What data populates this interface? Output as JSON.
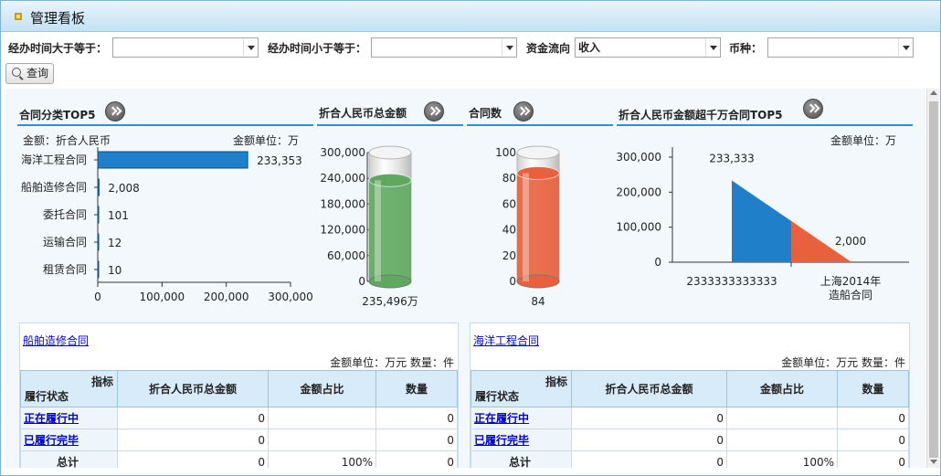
{
  "window": {
    "title": "管理看板"
  },
  "filters": [
    {
      "label": "经办时间大于等于：",
      "value": ""
    },
    {
      "label": "经办时间小于等于：",
      "value": ""
    },
    {
      "label": "资金流向",
      "value": "收入"
    },
    {
      "label": "币种：",
      "value": ""
    }
  ],
  "query_button": "查询",
  "sections": {
    "s1": "合同分类TOP5",
    "s2": "折合人民币总金额",
    "s3": "合同数",
    "s4": "折合人民币金额超千万合同TOP5"
  },
  "chart_data": [
    {
      "type": "bar",
      "title": "合同分类TOP5",
      "note_left": "金额：折合人民币",
      "note_right": "金额单位：万",
      "categories": [
        "海洋工程合同",
        "船舶造修合同",
        "委托合同",
        "运输合同",
        "租赁合同"
      ],
      "values": [
        233353,
        2008,
        101,
        12,
        10
      ],
      "value_labels": [
        "233,353",
        "2,008",
        "101",
        "12",
        "10"
      ],
      "xlim": [
        0,
        300000
      ],
      "xticks": [
        "0",
        "100,000",
        "200,000",
        "300,000"
      ],
      "color": "#1f7fc8"
    },
    {
      "type": "gauge",
      "title": "折合人民币总金额",
      "value": 235496,
      "value_label": "235,496万",
      "ylim": [
        0,
        300000
      ],
      "yticks": [
        "0",
        "60,000",
        "120,000",
        "180,000",
        "240,000",
        "300,000"
      ],
      "color": "#5fa85f"
    },
    {
      "type": "gauge",
      "title": "合同数",
      "value": 84,
      "value_label": "84",
      "ylim": [
        0,
        100
      ],
      "yticks": [
        "0",
        "20",
        "40",
        "60",
        "80",
        "100"
      ],
      "color": "#e8603c"
    },
    {
      "type": "area",
      "title": "折合人民币金额超千万合同TOP5",
      "note_right": "金额单位：万",
      "categories": [
        "2333333333333",
        "上海2014年造船合同"
      ],
      "category_lines": [
        [
          "2333333333333"
        ],
        [
          "上海2014年",
          "造船合同"
        ]
      ],
      "values": [
        233333,
        2000
      ],
      "value_labels": [
        "233,333",
        "2,000"
      ],
      "ylim": [
        0,
        300000
      ],
      "yticks": [
        "0",
        "100,000",
        "200,000",
        "300,000"
      ],
      "colors": [
        "#1f7fc8",
        "#e8603c"
      ]
    }
  ],
  "tables": [
    {
      "link": "船舶造修合同",
      "unit": "金额单位：万元  数量：件",
      "head": {
        "diag_top": "指标",
        "diag_bottom": "履行状态",
        "cols": [
          "折合人民币总金额",
          "金额占比",
          "数量"
        ]
      },
      "rows": [
        {
          "label": "正在履行中",
          "amount": "0",
          "ratio": "",
          "count": "0"
        },
        {
          "label": "已履行完毕",
          "amount": "0",
          "ratio": "",
          "count": "0"
        }
      ],
      "total": {
        "label": "总计",
        "amount": "0",
        "ratio": "100%",
        "count": "0"
      }
    },
    {
      "link": "海洋工程合同",
      "unit": "金额单位：万元  数量：件",
      "head": {
        "diag_top": "指标",
        "diag_bottom": "履行状态",
        "cols": [
          "折合人民币总金额",
          "金额占比",
          "数量"
        ]
      },
      "rows": [
        {
          "label": "正在履行中",
          "amount": "0",
          "ratio": "",
          "count": "0"
        },
        {
          "label": "已履行完毕",
          "amount": "0",
          "ratio": "",
          "count": "0"
        }
      ],
      "total": {
        "label": "总计",
        "amount": "0",
        "ratio": "100%",
        "count": "0"
      }
    }
  ]
}
